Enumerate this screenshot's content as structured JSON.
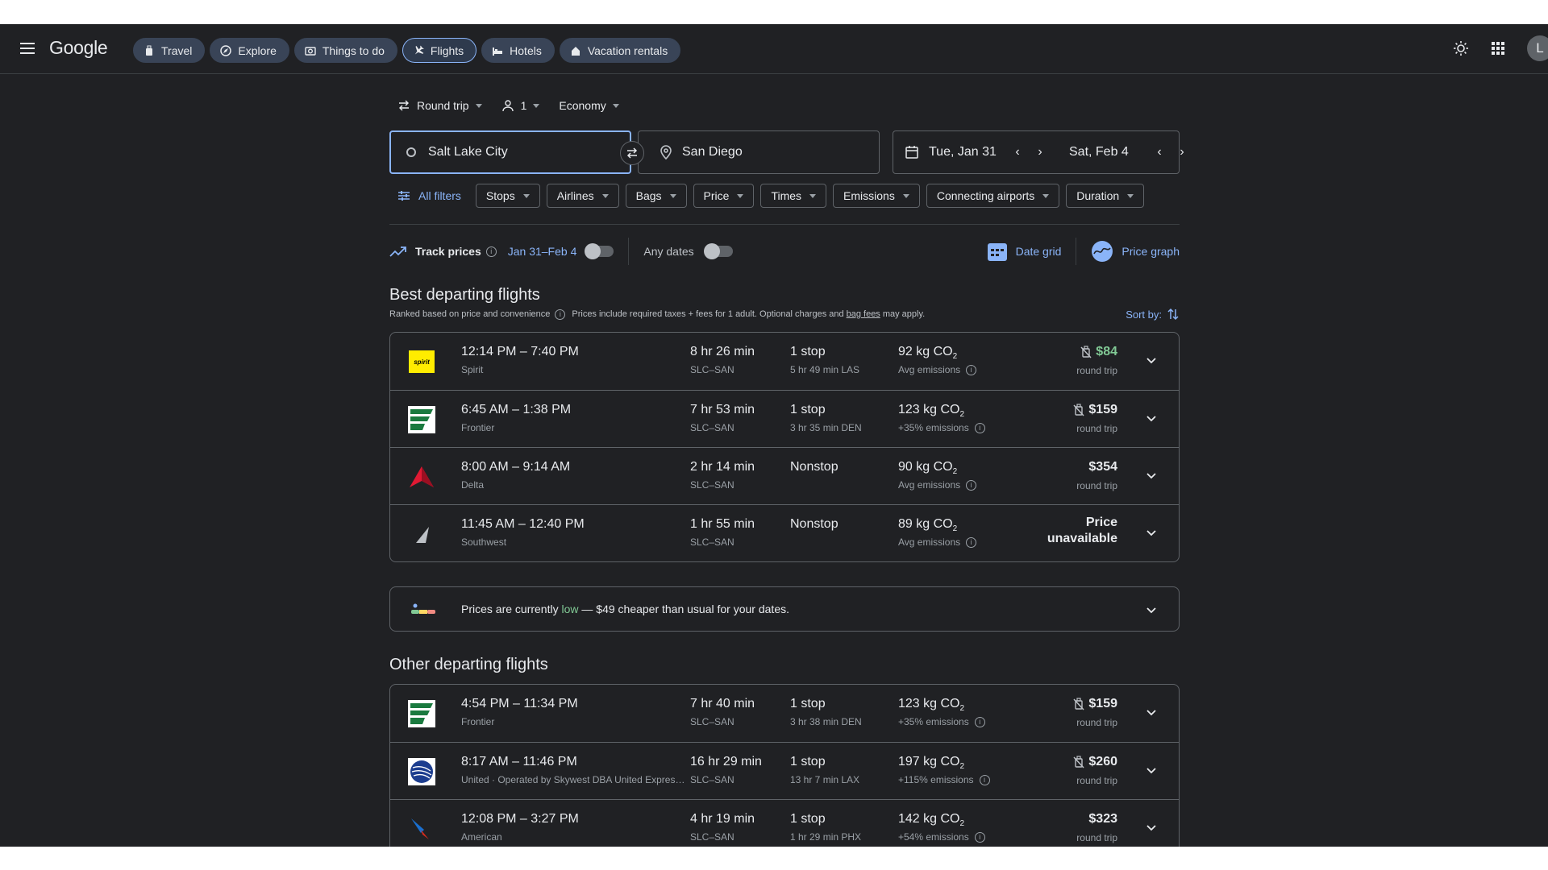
{
  "topbar": {
    "logo": "Google",
    "nav": [
      {
        "label": "Travel",
        "icon": "luggage-icon"
      },
      {
        "label": "Explore",
        "icon": "explore-icon"
      },
      {
        "label": "Things to do",
        "icon": "camera-icon"
      },
      {
        "label": "Flights",
        "icon": "plane-icon",
        "active": true
      },
      {
        "label": "Hotels",
        "icon": "bed-icon"
      },
      {
        "label": "Vacation rentals",
        "icon": "house-icon"
      }
    ],
    "avatar": "L"
  },
  "search": {
    "trip_type": "Round trip",
    "passengers": "1",
    "cabin": "Economy",
    "origin": "Salt Lake City",
    "destination": "San Diego",
    "depart_date": "Tue, Jan 31",
    "return_date": "Sat, Feb 4"
  },
  "filters": {
    "all": "All filters",
    "items": [
      "Stops",
      "Airlines",
      "Bags",
      "Price",
      "Times",
      "Emissions",
      "Connecting airports",
      "Duration"
    ]
  },
  "track": {
    "label": "Track prices",
    "range": "Jan 31–Feb 4",
    "any_dates": "Any dates",
    "date_grid": "Date grid",
    "price_graph": "Price graph"
  },
  "best": {
    "title": "Best departing flights",
    "ranked": "Ranked based on price and convenience",
    "prices_note": "Prices include required taxes + fees for 1 adult. Optional charges and",
    "bag_fees": "bag fees",
    "may_apply": "may apply.",
    "sort": "Sort by:",
    "flights": [
      {
        "times": "12:14 PM – 7:40 PM",
        "airline": "Spirit",
        "logo": "spirit",
        "duration": "8 hr 26 min",
        "route": "SLC–SAN",
        "stops": "1 stop",
        "layover": "5 hr 49 min LAS",
        "co2": "92 kg CO",
        "emissions": "Avg emissions",
        "price": "$84",
        "price_color": "#81c995",
        "price_note": "round trip",
        "no_bag_icon": true
      },
      {
        "times": "6:45 AM – 1:38 PM",
        "airline": "Frontier",
        "logo": "frontier",
        "duration": "7 hr 53 min",
        "route": "SLC–SAN",
        "stops": "1 stop",
        "layover": "3 hr 35 min DEN",
        "co2": "123 kg CO",
        "emissions": "+35% emissions",
        "price": "$159",
        "price_note": "round trip",
        "no_bag_icon": true
      },
      {
        "times": "8:00 AM – 9:14 AM",
        "airline": "Delta",
        "logo": "delta",
        "duration": "2 hr 14 min",
        "route": "SLC–SAN",
        "stops": "Nonstop",
        "layover": "",
        "co2": "90 kg CO",
        "emissions": "Avg emissions",
        "price": "$354",
        "price_note": "round trip",
        "no_bag_icon": false
      },
      {
        "times": "11:45 AM – 12:40 PM",
        "airline": "Southwest",
        "logo": "southwest",
        "duration": "1 hr 55 min",
        "route": "SLC–SAN",
        "stops": "Nonstop",
        "layover": "",
        "co2": "89 kg CO",
        "emissions": "Avg emissions",
        "price": "Price unavailable",
        "price_note": "",
        "no_bag_icon": false
      }
    ]
  },
  "insight": {
    "before": "Prices are currently",
    "low": "low",
    "after": "— $49 cheaper than usual for your dates."
  },
  "other": {
    "title": "Other departing flights",
    "flights": [
      {
        "times": "4:54 PM – 11:34 PM",
        "airline": "Frontier",
        "logo": "frontier",
        "duration": "7 hr 40 min",
        "route": "SLC–SAN",
        "stops": "1 stop",
        "layover": "3 hr 38 min DEN",
        "co2": "123 kg CO",
        "emissions": "+35% emissions",
        "price": "$159",
        "price_note": "round trip",
        "no_bag_icon": true
      },
      {
        "times": "8:17 AM – 11:46 PM",
        "airline": "United · Operated by Skywest DBA United Express...",
        "logo": "united",
        "duration": "16 hr 29 min",
        "route": "SLC–SAN",
        "stops": "1 stop",
        "layover": "13 hr 7 min LAX",
        "co2": "197 kg CO",
        "emissions": "+115% emissions",
        "price": "$260",
        "price_note": "round trip",
        "no_bag_icon": true
      },
      {
        "times": "12:08 PM – 3:27 PM",
        "airline": "American",
        "logo": "american",
        "duration": "4 hr 19 min",
        "route": "SLC–SAN",
        "stops": "1 stop",
        "layover": "1 hr 29 min PHX",
        "co2": "142 kg CO",
        "emissions": "+54% emissions",
        "price": "$323",
        "price_note": "round trip",
        "no_bag_icon": false
      }
    ]
  },
  "colors": {
    "accent": "#8ab4f8",
    "background": "#202124",
    "good_price": "#81c995"
  }
}
